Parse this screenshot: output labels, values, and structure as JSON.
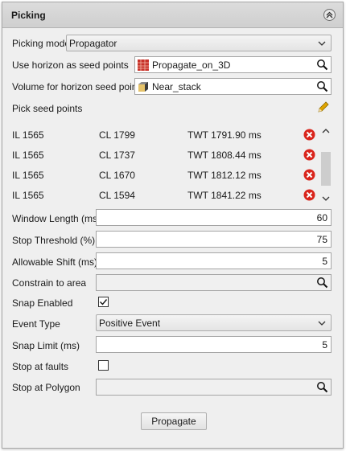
{
  "panel": {
    "title": "Picking"
  },
  "picking_mode": {
    "label": "Picking mode",
    "value": "Propagator"
  },
  "horizon_seed": {
    "label": "Use horizon as seed points",
    "value": "Propagate_on_3D"
  },
  "volume_seed": {
    "label": "Volume for horizon seed points",
    "value": "Near_stack"
  },
  "pick_seed": {
    "label": "Pick seed points"
  },
  "seed_points": [
    {
      "il": "IL 1565",
      "cl": "CL 1799",
      "twt": "TWT 1791.90 ms"
    },
    {
      "il": "IL 1565",
      "cl": "CL 1737",
      "twt": "TWT 1808.44 ms"
    },
    {
      "il": "IL 1565",
      "cl": "CL 1670",
      "twt": "TWT 1812.12 ms"
    },
    {
      "il": "IL 1565",
      "cl": "CL 1594",
      "twt": "TWT 1841.22 ms"
    }
  ],
  "window_length": {
    "label": "Window Length (ms)",
    "value": "60"
  },
  "stop_threshold": {
    "label": "Stop Threshold (%)",
    "value": "75"
  },
  "allowable_shift": {
    "label": "Allowable Shift (ms)",
    "value": "5"
  },
  "constrain_area": {
    "label": "Constrain to area",
    "value": ""
  },
  "snap_enabled": {
    "label": "Snap Enabled",
    "checked": true
  },
  "event_type": {
    "label": "Event Type",
    "value": "Positive Event"
  },
  "snap_limit": {
    "label": "Snap Limit (ms)",
    "value": "5"
  },
  "stop_faults": {
    "label": "Stop at faults",
    "checked": false
  },
  "stop_polygon": {
    "label": "Stop at Polygon",
    "value": ""
  },
  "propagate_button": {
    "label": "Propagate"
  },
  "colors": {
    "delete_red": "#d9241b",
    "pencil": "#e0a400",
    "horizon_icon": "#c8322a"
  }
}
